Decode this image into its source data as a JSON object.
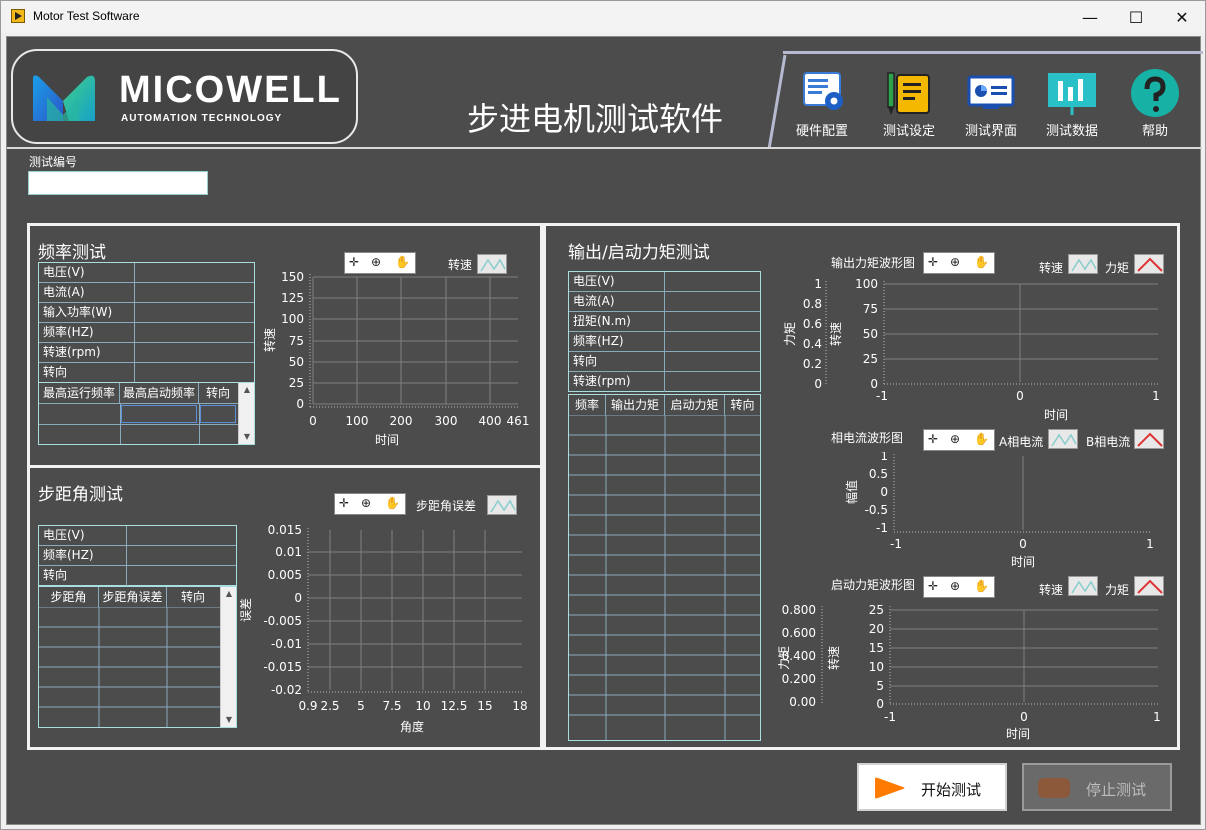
{
  "window": {
    "title": "Motor Test Software",
    "min": "—",
    "max": "☐",
    "close": "✕"
  },
  "logo": {
    "name": "MICOWELL",
    "sub": "AUTOMATION TECHNOLOGY"
  },
  "header": {
    "title": "步进电机测试软件"
  },
  "nav": [
    {
      "label": "硬件配置",
      "icon": "hardware-config-icon"
    },
    {
      "label": "测试设定",
      "icon": "test-settings-icon"
    },
    {
      "label": "测试界面",
      "icon": "test-screen-icon"
    },
    {
      "label": "测试数据",
      "icon": "test-data-icon"
    },
    {
      "label": "帮助",
      "icon": "help-icon"
    }
  ],
  "test_no": {
    "label": "测试编号",
    "value": ""
  },
  "freq": {
    "title": "频率测试",
    "rows": [
      "电压(V)",
      "电流(A)",
      "输入功率(W)",
      "频率(HZ)",
      "转速(rpm)",
      "转向"
    ],
    "cols": [
      "最高运行频率",
      "最高启动频率",
      "转向"
    ],
    "legend": "转速",
    "xlabel": "时间",
    "ylabel": "转速",
    "xticks": [
      "0",
      "100",
      "200",
      "300",
      "400",
      "461"
    ],
    "yticks": [
      "150",
      "125",
      "100",
      "75",
      "50",
      "25",
      "0"
    ]
  },
  "step": {
    "title": "步距角测试",
    "rows": [
      "电压(V)",
      "频率(HZ)",
      "转向"
    ],
    "cols": [
      "步距角",
      "步距角误差",
      "转向"
    ],
    "legend": "步距角误差",
    "xlabel": "角度",
    "ylabel": "误差",
    "xticks": [
      "0.9",
      "2.5",
      "5",
      "7.5",
      "10",
      "12.5",
      "15",
      "18"
    ],
    "yticks": [
      "0.015",
      "0.01",
      "0.005",
      "0",
      "-0.005",
      "-0.01",
      "-0.015",
      "-0.02"
    ]
  },
  "torque": {
    "title": "输出/启动力矩测试",
    "rows": [
      "电压(V)",
      "电流(A)",
      "扭矩(N.m)",
      "频率(HZ)",
      "转向",
      "转速(rpm)"
    ],
    "cols": [
      "频率",
      "输出力矩",
      "启动力矩",
      "转向"
    ],
    "g1": {
      "title": "输出力矩波形图",
      "legend1": "转速",
      "legend2": "力矩",
      "xlabel": "时间",
      "ylabel1": "力矩",
      "ylabel2": "转速",
      "yticks_left": [
        "1",
        "0.8",
        "0.6",
        "0.4",
        "0.2",
        "0"
      ],
      "yticks_right": [
        "100",
        "75",
        "50",
        "25",
        "0"
      ],
      "xticks": [
        "-1",
        "0",
        "1"
      ]
    },
    "g2": {
      "title": "相电流波形图",
      "legend1": "A相电流",
      "legend2": "B相电流",
      "xlabel": "时间",
      "ylabel": "幅值",
      "yticks": [
        "1",
        "0.5",
        "0",
        "-0.5",
        "-1"
      ],
      "xticks": [
        "-1",
        "0",
        "1"
      ]
    },
    "g3": {
      "title": "启动力矩波形图",
      "legend1": "转速",
      "legend2": "力矩",
      "xlabel": "时间",
      "ylabel1": "力矩",
      "ylabel2": "转速",
      "yticks_left": [
        "0.800",
        "0.600",
        "0.400",
        "0.200",
        "0.00"
      ],
      "yticks_right": [
        "25",
        "20",
        "15",
        "10",
        "5",
        "0"
      ],
      "xticks": [
        "-1",
        "0",
        "1"
      ]
    }
  },
  "buttons": {
    "start": "开始测试",
    "stop": "停止测试"
  },
  "colors": {
    "bg": "#4c4c4c",
    "accent_orange": "#ff7a00",
    "table_border": "#a9dede"
  }
}
